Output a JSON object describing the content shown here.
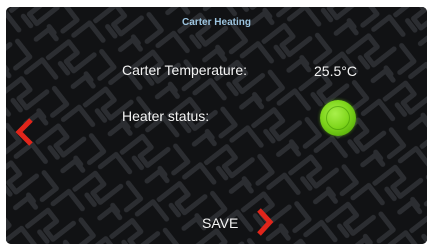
{
  "screen": {
    "title": "Carter Heating"
  },
  "fields": {
    "temperature_label": "Carter Temperature:",
    "temperature_value": "25.5°C",
    "heater_label": "Heater status:",
    "heater_on": true
  },
  "controls": {
    "save_label": "SAVE",
    "back_icon": "chevron-left-icon",
    "save_icon": "chevron-right-icon"
  },
  "colors": {
    "background": "#111214",
    "pattern": "#2b2d31",
    "title": "#9cc4df",
    "arrow": "#e0251b",
    "status_on": "#7fd61c"
  }
}
